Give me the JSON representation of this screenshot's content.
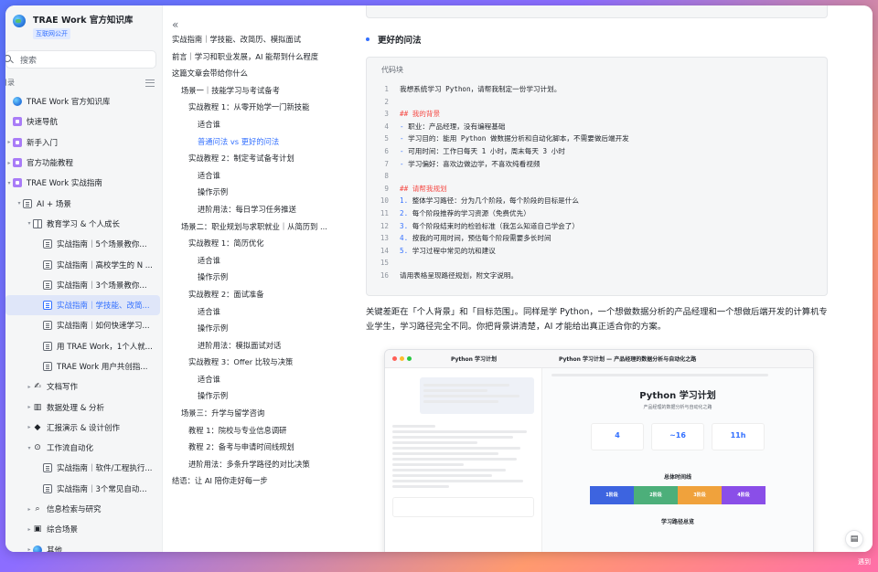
{
  "sidebar": {
    "title": "TRAE Work 官方知识库",
    "badge": "互联网公开",
    "search_placeholder": "搜索",
    "directory_label": "目录",
    "items": [
      {
        "label": "TRAE Work 官方知识库",
        "icon": "globe-icon",
        "depth": 0,
        "caret": ""
      },
      {
        "label": "快速导航",
        "icon": "purple-page-icon",
        "depth": 0,
        "caret": ""
      },
      {
        "label": "新手入门",
        "icon": "purple-page-icon",
        "depth": 0,
        "caret": "▸"
      },
      {
        "label": "官方功能教程",
        "icon": "purple-page-icon",
        "depth": 0,
        "caret": "▸"
      },
      {
        "label": "TRAE Work 实战指南",
        "icon": "purple-page-icon",
        "depth": 0,
        "caret": "▾"
      },
      {
        "label": "AI + 场景",
        "icon": "doc-icon",
        "depth": 1,
        "caret": "▾"
      },
      {
        "label": "教育学习 & 个人成长",
        "icon": "book-icon",
        "depth": 2,
        "caret": "▾"
      },
      {
        "label": "实战指南｜5个场景教你...",
        "icon": "doc-icon",
        "depth": 3,
        "caret": ""
      },
      {
        "label": "实战指南｜高校学生的 N ...",
        "icon": "doc-icon",
        "depth": 3,
        "caret": ""
      },
      {
        "label": "实战指南｜3个场景教你...",
        "icon": "doc-icon",
        "depth": 3,
        "caret": ""
      },
      {
        "label": "实战指南｜学技能、改简...",
        "icon": "doc-icon",
        "depth": 3,
        "caret": "",
        "active": true
      },
      {
        "label": "实战指南｜如何快速学习...",
        "icon": "doc-icon",
        "depth": 3,
        "caret": ""
      },
      {
        "label": "用 TRAE Work，1个人就...",
        "icon": "doc-icon",
        "depth": 3,
        "caret": ""
      },
      {
        "label": "TRAE Work 用户共创指...",
        "icon": "doc-icon",
        "depth": 3,
        "caret": ""
      },
      {
        "label": "文档写作",
        "icon": "pen-emoji-icon",
        "depth": 2,
        "caret": "▸"
      },
      {
        "label": "数据处理 & 分析",
        "icon": "chart-emoji-icon",
        "depth": 2,
        "caret": "▸"
      },
      {
        "label": "汇报演示 & 设计创作",
        "icon": "palette-emoji-icon",
        "depth": 2,
        "caret": "▸"
      },
      {
        "label": "工作流自动化",
        "icon": "robot-emoji-icon",
        "depth": 2,
        "caret": "▾"
      },
      {
        "label": "实战指南｜软件/工程执行...",
        "icon": "doc-icon",
        "depth": 3,
        "caret": ""
      },
      {
        "label": "实战指南｜3个常见自动...",
        "icon": "doc-icon",
        "depth": 3,
        "caret": ""
      },
      {
        "label": "信息检索与研究",
        "icon": "magnifier-emoji-icon",
        "depth": 2,
        "caret": "▸"
      },
      {
        "label": "综合场景",
        "icon": "box-emoji-icon",
        "depth": 2,
        "caret": "▸"
      },
      {
        "label": "其他",
        "icon": "globe-icon",
        "depth": 2,
        "caret": "▸"
      }
    ]
  },
  "toc": {
    "items": [
      {
        "label": "实战指南｜学技能、改简历、模拟面试",
        "level": 1
      },
      {
        "label": "前言｜学习和职业发展，AI 能帮到什么程度",
        "level": 1
      },
      {
        "label": "这篇文章会带给你什么",
        "level": 1
      },
      {
        "label": "场景一｜技能学习与考试备考",
        "level": 2
      },
      {
        "label": "实战教程 1：从零开始学一门新技能",
        "level": 3
      },
      {
        "label": "适合谁",
        "level": 4
      },
      {
        "label": "普通问法 vs 更好的问法",
        "level": 4,
        "active": true
      },
      {
        "label": "实战教程 2：制定考试备考计划",
        "level": 3
      },
      {
        "label": "适合谁",
        "level": 4
      },
      {
        "label": "操作示例",
        "level": 4
      },
      {
        "label": "进阶用法：每日学习任务推送",
        "level": 4
      },
      {
        "label": "场景二：职业规划与求职就业｜从简历到 ...",
        "level": 2
      },
      {
        "label": "实战教程 1：简历优化",
        "level": 3
      },
      {
        "label": "适合谁",
        "level": 4
      },
      {
        "label": "操作示例",
        "level": 4
      },
      {
        "label": "实战教程 2：面试准备",
        "level": 3
      },
      {
        "label": "适合谁",
        "level": 4
      },
      {
        "label": "操作示例",
        "level": 4
      },
      {
        "label": "进阶用法：模拟面试对话",
        "level": 4
      },
      {
        "label": "实战教程 3：Offer 比较与决策",
        "level": 3
      },
      {
        "label": "适合谁",
        "level": 4
      },
      {
        "label": "操作示例",
        "level": 4
      },
      {
        "label": "场景三：升学与留学咨询",
        "level": 2
      },
      {
        "label": "教程 1：院校与专业信息调研",
        "level": 3
      },
      {
        "label": "教程 2：备考与申请时间线规划",
        "level": 3
      },
      {
        "label": "进阶用法：多条升学路径的对比决策",
        "level": 3
      },
      {
        "label": "结语：让 AI 陪你走好每一步",
        "level": 1
      }
    ]
  },
  "content": {
    "heading": "更好的问法",
    "code_label": "代码块",
    "code_lines": [
      {
        "n": "1",
        "text": "我想系统学习 Python，请帮我制定一份学习计划。",
        "style": ""
      },
      {
        "n": "2",
        "text": "",
        "style": ""
      },
      {
        "n": "3",
        "text": "## 我的背景",
        "style": "red"
      },
      {
        "n": "4",
        "marker": "- ",
        "text": "职业：产品经理，没有编程基础",
        "style": "mixed"
      },
      {
        "n": "5",
        "marker": "- ",
        "text": "学习目的：能用 Python 做数据分析和自动化脚本，不需要做后端开发",
        "style": "mixed"
      },
      {
        "n": "6",
        "marker": "- ",
        "text": "可用时间：工作日每天 1 小时，周末每天 3 小时",
        "style": "mixed"
      },
      {
        "n": "7",
        "marker": "- ",
        "text": "学习偏好：喜欢边做边学，不喜欢纯看视频",
        "style": "mixed"
      },
      {
        "n": "8",
        "text": "",
        "style": ""
      },
      {
        "n": "9",
        "text": "## 请帮我规划",
        "style": "red"
      },
      {
        "n": "10",
        "marker": "1. ",
        "text": "整体学习路径：分为几个阶段，每个阶段的目标是什么",
        "style": "mixed"
      },
      {
        "n": "11",
        "marker": "2. ",
        "text": "每个阶段推荐的学习资源（免费优先）",
        "style": "mixed"
      },
      {
        "n": "12",
        "marker": "3. ",
        "text": "每个阶段结束时的检验标准（我怎么知道自己学会了）",
        "style": "mixed"
      },
      {
        "n": "13",
        "marker": "4. ",
        "text": "按我的可用时间，预估每个阶段需要多长时间",
        "style": "mixed"
      },
      {
        "n": "14",
        "marker": "5. ",
        "text": "学习过程中常见的坑和建议",
        "style": "mixed"
      },
      {
        "n": "15",
        "text": "",
        "style": ""
      },
      {
        "n": "16",
        "text": "请用表格呈现路径规划，附文字说明。",
        "style": ""
      }
    ],
    "paragraph": "关键差距在「个人背景」和「目标范围」。同样是学 Python，一个想做数据分析的产品经理和一个想做后端开发的计算机专业学生，学习路径完全不同。你把背景讲清楚，AI 才能给出真正适合你的方案。",
    "screenshot": {
      "tab_title": "Python 学习计划",
      "right_tab_title": "Python 学习计划 — 产品经理的数据分析与自动化之路",
      "page_title": "Python 学习计划",
      "page_subtitle": "产品经理的数据分析与自动化之路",
      "stats": [
        "4",
        "~16",
        "11h"
      ],
      "phases": [
        "1阶段",
        "2阶段",
        "3阶段",
        "4阶段"
      ],
      "phase_colors": [
        "#3d64e0",
        "#4caf7a",
        "#f0a23c",
        "#8a4ee8"
      ],
      "section1": "总体时间线",
      "section2": "学习路径总览"
    }
  },
  "corner_label": "遇到",
  "colors": {
    "accent": "#3370ff",
    "code_heading": "#f54a45"
  }
}
